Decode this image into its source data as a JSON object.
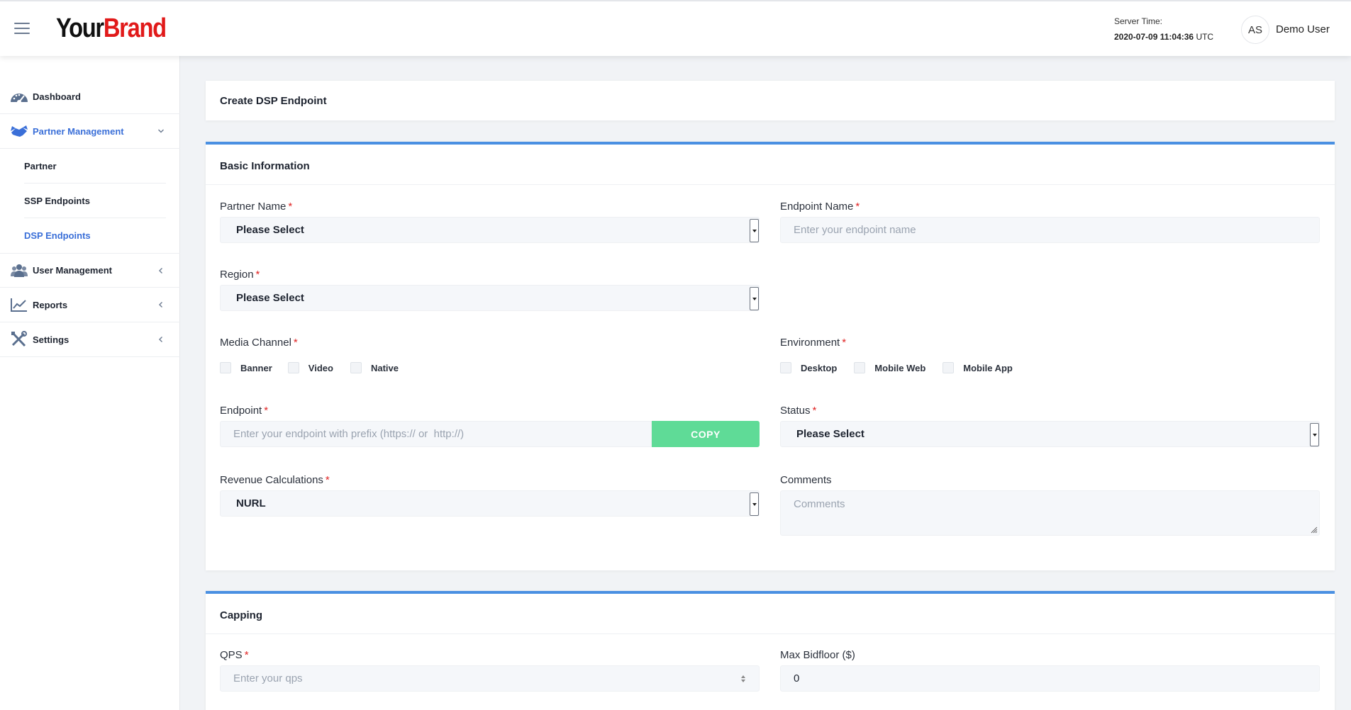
{
  "header": {
    "logo_part1": "Your",
    "logo_part2": "Brand",
    "server_time_label": "Server Time:",
    "server_time_value": "2020-07-09 11:04:36",
    "server_time_zone": "UTC",
    "avatar_initials": "AS",
    "user_name": "Demo User"
  },
  "sidebar": {
    "items": [
      {
        "label": "Dashboard",
        "icon": "dashboard-gauge-icon"
      },
      {
        "label": "Partner Management",
        "icon": "handshake-icon",
        "active": true
      },
      {
        "label": "User Management",
        "icon": "users-icon"
      },
      {
        "label": "Reports",
        "icon": "chart-line-icon"
      },
      {
        "label": "Settings",
        "icon": "tools-icon"
      }
    ],
    "sub_items": [
      {
        "label": "Partner"
      },
      {
        "label": "SSP Endpoints"
      },
      {
        "label": "DSP Endpoints",
        "current": true
      }
    ]
  },
  "page": {
    "title": "Create DSP Endpoint"
  },
  "basic": {
    "title": "Basic Information",
    "partner_name_label": "Partner Name",
    "partner_name_value": "Please Select",
    "endpoint_name_label": "Endpoint Name",
    "endpoint_name_placeholder": "Enter your endpoint name",
    "region_label": "Region",
    "region_value": "Please Select",
    "media_channel_label": "Media Channel",
    "media_channels": [
      "Banner",
      "Video",
      "Native"
    ],
    "environment_label": "Environment",
    "environments": [
      "Desktop",
      "Mobile Web",
      "Mobile App"
    ],
    "endpoint_label": "Endpoint",
    "endpoint_placeholder": "Enter your endpoint with prefix (https:// or  http://)",
    "copy_label": "COPY",
    "status_label": "Status",
    "status_value": "Please Select",
    "revenue_label": "Revenue Calculations",
    "revenue_value": "NURL",
    "comments_label": "Comments",
    "comments_placeholder": "Comments"
  },
  "capping": {
    "title": "Capping",
    "qps_label": "QPS",
    "qps_placeholder": "Enter your qps",
    "max_bidfloor_label": "Max Bidfloor ($)",
    "max_bidfloor_value": "0"
  },
  "colors": {
    "accent_blue": "#4a90e2",
    "active_link": "#3a6fd8",
    "copy_green": "#5fdb97",
    "required_red": "#e02424",
    "brand_red": "#e11a1a"
  }
}
